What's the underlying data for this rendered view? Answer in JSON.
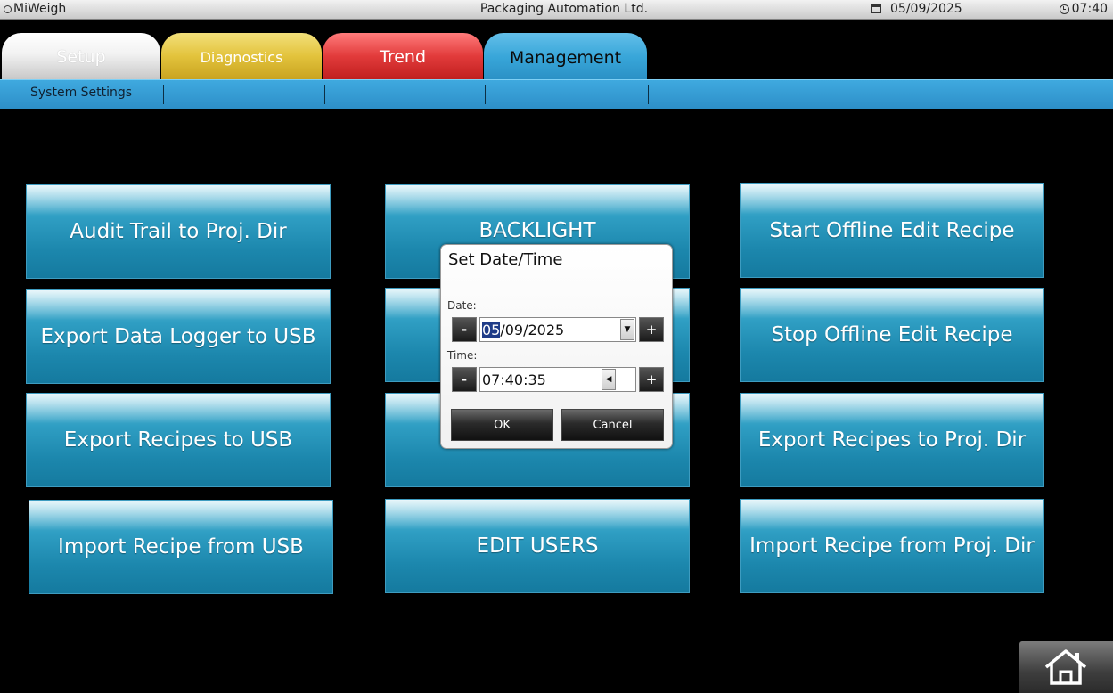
{
  "titlebar": {
    "app_name": "MiWeigh",
    "company": "Packaging Automation Ltd.",
    "date": "05/09/2025",
    "time": "07:40"
  },
  "tabs": [
    {
      "label": "Setup"
    },
    {
      "label": "Diagnostics"
    },
    {
      "label": "Trend"
    },
    {
      "label": "Management",
      "active": true
    }
  ],
  "subnav": {
    "items": [
      {
        "label": "System Settings"
      }
    ]
  },
  "buttons": {
    "audit_trail": "Audit Trail to Proj. Dir",
    "backlight": "BACKLIGHT",
    "start_offline": "Start Offline Edit Recipe",
    "export_logger": "Export Data Logger to USB",
    "stop_offline": "Stop Offline Edit Recipe",
    "export_recipes_usb": "Export Recipes to USB",
    "export_recipes_proj": "Export Recipes to Proj. Dir",
    "import_recipe_usb": "Import Recipe from USB",
    "edit_users": "EDIT USERS",
    "import_recipe_proj": "Import Recipe from Proj. Dir"
  },
  "dialog": {
    "title": "Set Date/Time",
    "date_label": "Date:",
    "date_highlight": "05",
    "date_rest": "/09/2025",
    "time_label": "Time:",
    "time_value": "07:40:35",
    "minus": "-",
    "plus": "+",
    "ok": "OK",
    "cancel": "Cancel"
  },
  "icons": {
    "home": "home-icon",
    "calendar": "calendar-icon",
    "clock": "clock-icon",
    "logo": "logo-icon"
  }
}
